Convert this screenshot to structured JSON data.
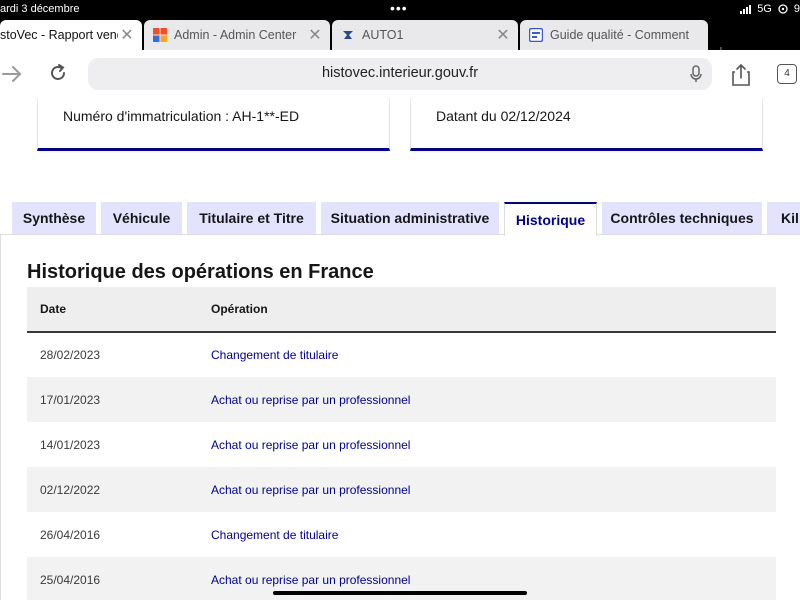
{
  "status_bar": {
    "date": "ardi 3 décembre",
    "dots": "•••",
    "network": "5G",
    "battery_fragment": "9"
  },
  "browser_tabs": [
    {
      "title": "stoVec - Rapport vende",
      "favicon": "none",
      "active": true
    },
    {
      "title": "Admin - Admin Center",
      "favicon": "office-squares-icon",
      "active": false
    },
    {
      "title": "AUTO1",
      "favicon": "auto1-icon",
      "active": false
    },
    {
      "title": "Guide qualité - Comment",
      "favicon": "forms-icon",
      "active": false
    }
  ],
  "toolbar": {
    "url": "histovec.interieur.gouv.fr",
    "tab_count": "4"
  },
  "cards": {
    "left": {
      "text": "Numéro d'immatriculation : AH-1**-ED"
    },
    "right": {
      "text": "Datant du 02/12/2024"
    }
  },
  "page_tabs": [
    {
      "label": "Synthèse"
    },
    {
      "label": "Véhicule"
    },
    {
      "label": "Titulaire et Titre"
    },
    {
      "label": "Situation administrative"
    },
    {
      "label": "Historique"
    },
    {
      "label": "Contrôles techniques"
    },
    {
      "label": "Kil"
    }
  ],
  "history": {
    "title": "Historique des opérations en France",
    "columns": {
      "date": "Date",
      "operation": "Opération"
    },
    "rows": [
      {
        "date": "28/02/2023",
        "operation": "Changement de titulaire"
      },
      {
        "date": "17/01/2023",
        "operation": "Achat ou reprise par un professionnel"
      },
      {
        "date": "14/01/2023",
        "operation": "Achat ou reprise par un professionnel"
      },
      {
        "date": "02/12/2022",
        "operation": "Achat ou reprise par un professionnel"
      },
      {
        "date": "26/04/2016",
        "operation": "Changement de titulaire"
      },
      {
        "date": "25/04/2016",
        "operation": "Achat ou reprise par un professionnel"
      }
    ]
  },
  "colors": {
    "accent": "#000091",
    "tab_bg": "#e3e3fd"
  }
}
